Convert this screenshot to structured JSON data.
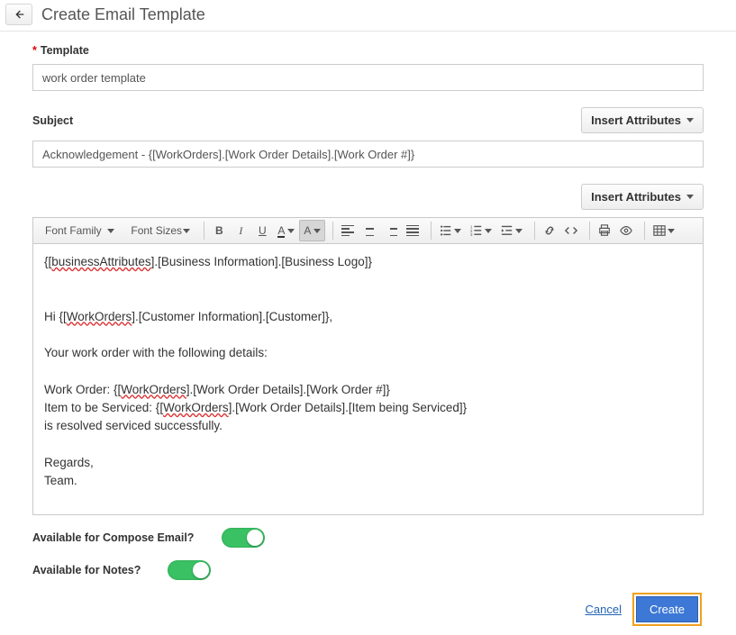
{
  "header": {
    "title": "Create Email Template"
  },
  "template": {
    "label": "Template",
    "value": "work order template"
  },
  "subject": {
    "label": "Subject",
    "insert_attributes_label": "Insert Attributes",
    "value": "Acknowledgement - {[WorkOrders].[Work Order Details].[Work Order #]}"
  },
  "body_section": {
    "insert_attributes_label": "Insert Attributes"
  },
  "toolbar": {
    "font_family": "Font Family",
    "font_sizes": "Font Sizes",
    "bold": "B",
    "italic": "I",
    "underline": "U"
  },
  "editor": {
    "line1_a": "{[",
    "line1_b": "businessAttributes",
    "line1_c": "].[Business Information].[Business Logo]}",
    "line2_a": "Hi {[",
    "line2_b": "WorkOrders",
    "line2_c": "].[Customer Information].[Customer]},",
    "line3": "Your work order with the following details:",
    "line4_a": "Work Order: {[",
    "line4_b": "WorkOrders",
    "line4_c": "].[Work Order Details].[Work Order #]}",
    "line5_a": "Item to be Serviced: {[",
    "line5_b": "WorkOrders",
    "line5_c": "].[Work Order Details].[Item being Serviced]}",
    "line6": "is resolved serviced successfully.",
    "line7": "Regards,",
    "line8": "Team."
  },
  "options": {
    "compose_label": "Available for Compose Email?",
    "notes_label": "Available for Notes?",
    "compose_on": true,
    "notes_on": true
  },
  "footer": {
    "cancel": "Cancel",
    "create": "Create"
  }
}
